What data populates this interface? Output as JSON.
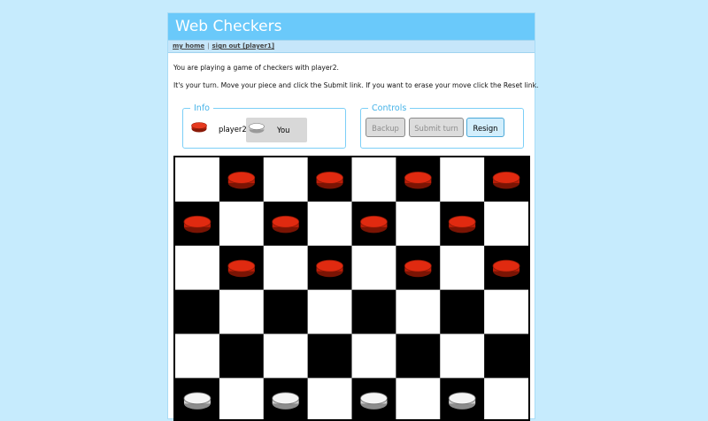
{
  "app": {
    "title": "Web Checkers"
  },
  "nav": {
    "home_link": "my home",
    "separator": "|",
    "signout_link": "sign out [player1]"
  },
  "messages": {
    "opponent_line": "You are playing a game of checkers with player2.",
    "turn_line": "It's your turn. Move your piece and click the Submit link. If you want to erase your move click the Reset link."
  },
  "info": {
    "legend": "Info",
    "opponent_name": "player2",
    "opponent_color": "red",
    "you_label": "You",
    "you_color": "white"
  },
  "controls": {
    "legend": "Controls",
    "backup_label": "Backup",
    "submit_label": "Submit turn",
    "resign_label": "Resign",
    "backup_enabled": false,
    "submit_enabled": false,
    "resign_enabled": true
  },
  "board": {
    "size": 8,
    "visible_rows": 6,
    "top_left_square": "light",
    "colors": {
      "light": "#ffffff",
      "dark": "#000000",
      "red_piece": "#e02a10",
      "white_piece": "#f4f4f4"
    },
    "pieces": [
      {
        "row": 0,
        "col": 1,
        "color": "red"
      },
      {
        "row": 0,
        "col": 3,
        "color": "red"
      },
      {
        "row": 0,
        "col": 5,
        "color": "red"
      },
      {
        "row": 0,
        "col": 7,
        "color": "red"
      },
      {
        "row": 1,
        "col": 0,
        "color": "red"
      },
      {
        "row": 1,
        "col": 2,
        "color": "red"
      },
      {
        "row": 1,
        "col": 4,
        "color": "red"
      },
      {
        "row": 1,
        "col": 6,
        "color": "red"
      },
      {
        "row": 2,
        "col": 1,
        "color": "red"
      },
      {
        "row": 2,
        "col": 3,
        "color": "red"
      },
      {
        "row": 2,
        "col": 5,
        "color": "red"
      },
      {
        "row": 2,
        "col": 7,
        "color": "red"
      },
      {
        "row": 5,
        "col": 0,
        "color": "white"
      },
      {
        "row": 5,
        "col": 2,
        "color": "white"
      },
      {
        "row": 5,
        "col": 4,
        "color": "white"
      },
      {
        "row": 5,
        "col": 6,
        "color": "white"
      }
    ]
  }
}
